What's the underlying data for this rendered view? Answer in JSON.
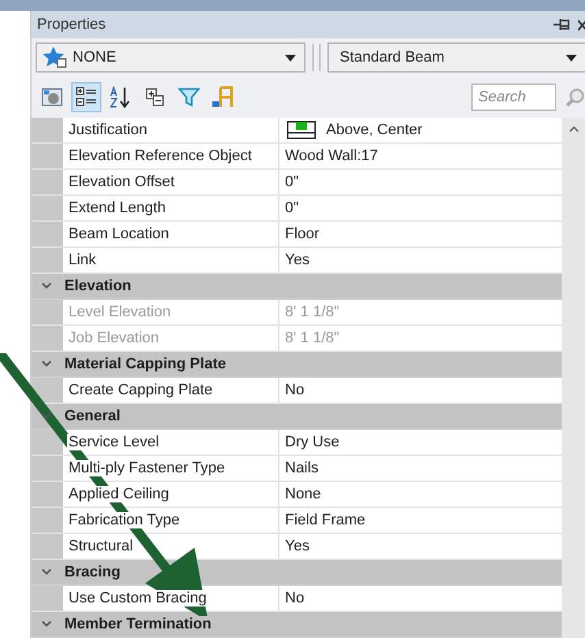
{
  "panel": {
    "title": "Properties"
  },
  "selectors": [
    {
      "value": "NONE"
    },
    {
      "value": "Standard Beam"
    }
  ],
  "search": {
    "placeholder": "Search"
  },
  "toolbar": [
    {
      "kind": "preview",
      "selected": false
    },
    {
      "kind": "categorized",
      "selected": true
    },
    {
      "kind": "alphabetical",
      "selected": false
    },
    {
      "kind": "expand",
      "selected": false
    },
    {
      "kind": "filter",
      "selected": false
    },
    {
      "kind": "chair",
      "selected": false
    }
  ],
  "rows": [
    {
      "kind": "property",
      "name": "Justification",
      "value": "Above, Center",
      "icon": true,
      "disabled": false
    },
    {
      "kind": "property",
      "name": "Elevation Reference Object",
      "value": "Wood Wall:17",
      "disabled": false
    },
    {
      "kind": "property",
      "name": "Elevation Offset",
      "value": "0\"",
      "disabled": false
    },
    {
      "kind": "property",
      "name": "Extend Length",
      "value": "0\"",
      "disabled": false
    },
    {
      "kind": "property",
      "name": "Beam Location",
      "value": "Floor",
      "disabled": false
    },
    {
      "kind": "property",
      "name": "Link",
      "value": "Yes",
      "disabled": false
    },
    {
      "kind": "category",
      "name": "Elevation",
      "expanded": true
    },
    {
      "kind": "property",
      "name": "Level Elevation",
      "value": "8' 1 1/8\"",
      "disabled": true
    },
    {
      "kind": "property",
      "name": "Job Elevation",
      "value": "8' 1 1/8\"",
      "disabled": true
    },
    {
      "kind": "category",
      "name": "Material Capping Plate",
      "expanded": true
    },
    {
      "kind": "property",
      "name": "Create Capping Plate",
      "value": "No",
      "disabled": false
    },
    {
      "kind": "category",
      "name": "General",
      "expanded": true
    },
    {
      "kind": "property",
      "name": "Service Level",
      "value": "Dry Use",
      "disabled": false
    },
    {
      "kind": "property",
      "name": "Multi-ply Fastener Type",
      "value": "Nails",
      "disabled": false
    },
    {
      "kind": "property",
      "name": "Applied Ceiling",
      "value": "None",
      "disabled": false
    },
    {
      "kind": "property",
      "name": "Fabrication Type",
      "value": "Field Frame",
      "disabled": false
    },
    {
      "kind": "property",
      "name": "Structural",
      "value": "Yes",
      "disabled": false
    },
    {
      "kind": "category",
      "name": "Bracing",
      "expanded": true
    },
    {
      "kind": "property",
      "name": "Use Custom Bracing",
      "value": "No",
      "disabled": false
    },
    {
      "kind": "category",
      "name": "Member Termination",
      "expanded": true
    }
  ]
}
